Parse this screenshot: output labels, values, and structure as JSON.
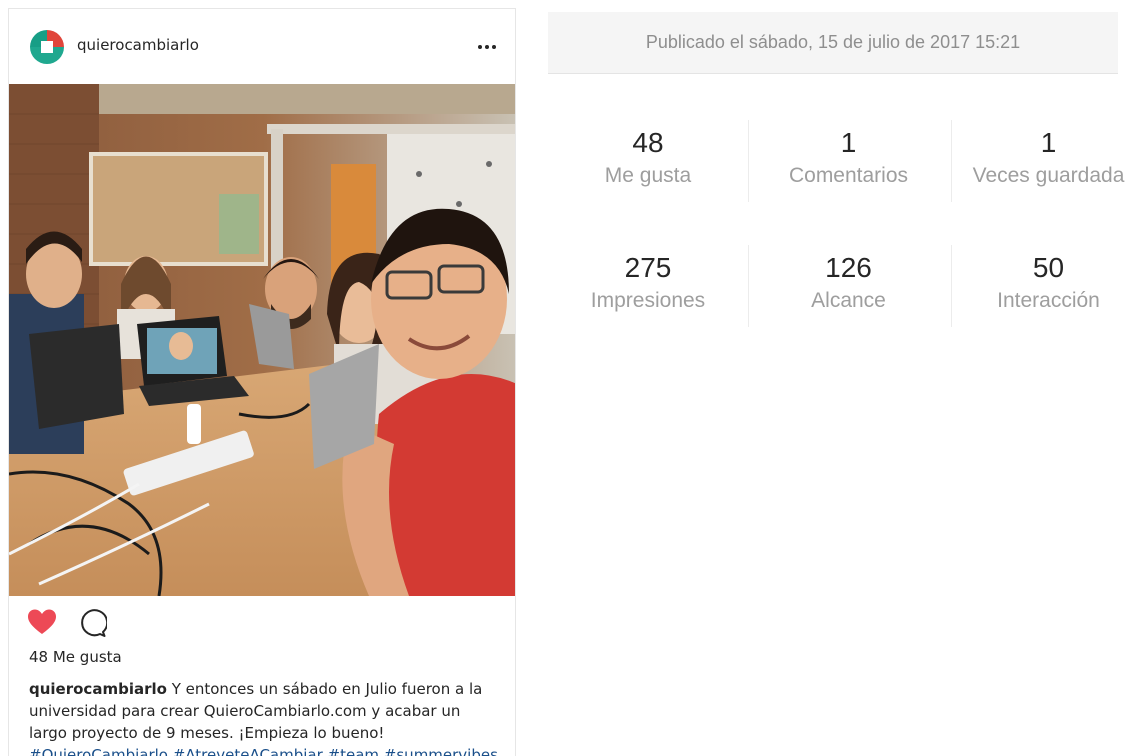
{
  "post": {
    "username": "quierocambiarlo",
    "more_icon": "more-horizontal-icon",
    "photo_alt": "",
    "likes_text": "48 Me gusta",
    "caption_user": "quierocambiarlo",
    "caption_text": " Y entonces un sábado en Julio fueron a la universidad para crear QuieroCambiarlo.com y acabar un largo proyecto de 9 meses. ¡Empieza lo bueno!",
    "caption_tags": "#QuieroCambiarlo #AtreveteACambiar #team #summervibes",
    "colors": {
      "heart": "#ed4956",
      "tags": "#1a4f8a",
      "brand_teal": "#1fa88f",
      "brand_red": "#e0453a"
    }
  },
  "stats": {
    "published": "Publicado el sábado, 15 de julio de 2017 15:21",
    "row1": [
      {
        "value": "48",
        "label": "Me gusta"
      },
      {
        "value": "1",
        "label": "Comentarios"
      },
      {
        "value": "1",
        "label": "Veces guardada"
      }
    ],
    "row2": [
      {
        "value": "275",
        "label": "Impresiones"
      },
      {
        "value": "126",
        "label": "Alcance"
      },
      {
        "value": "50",
        "label": "Interacción"
      }
    ]
  }
}
